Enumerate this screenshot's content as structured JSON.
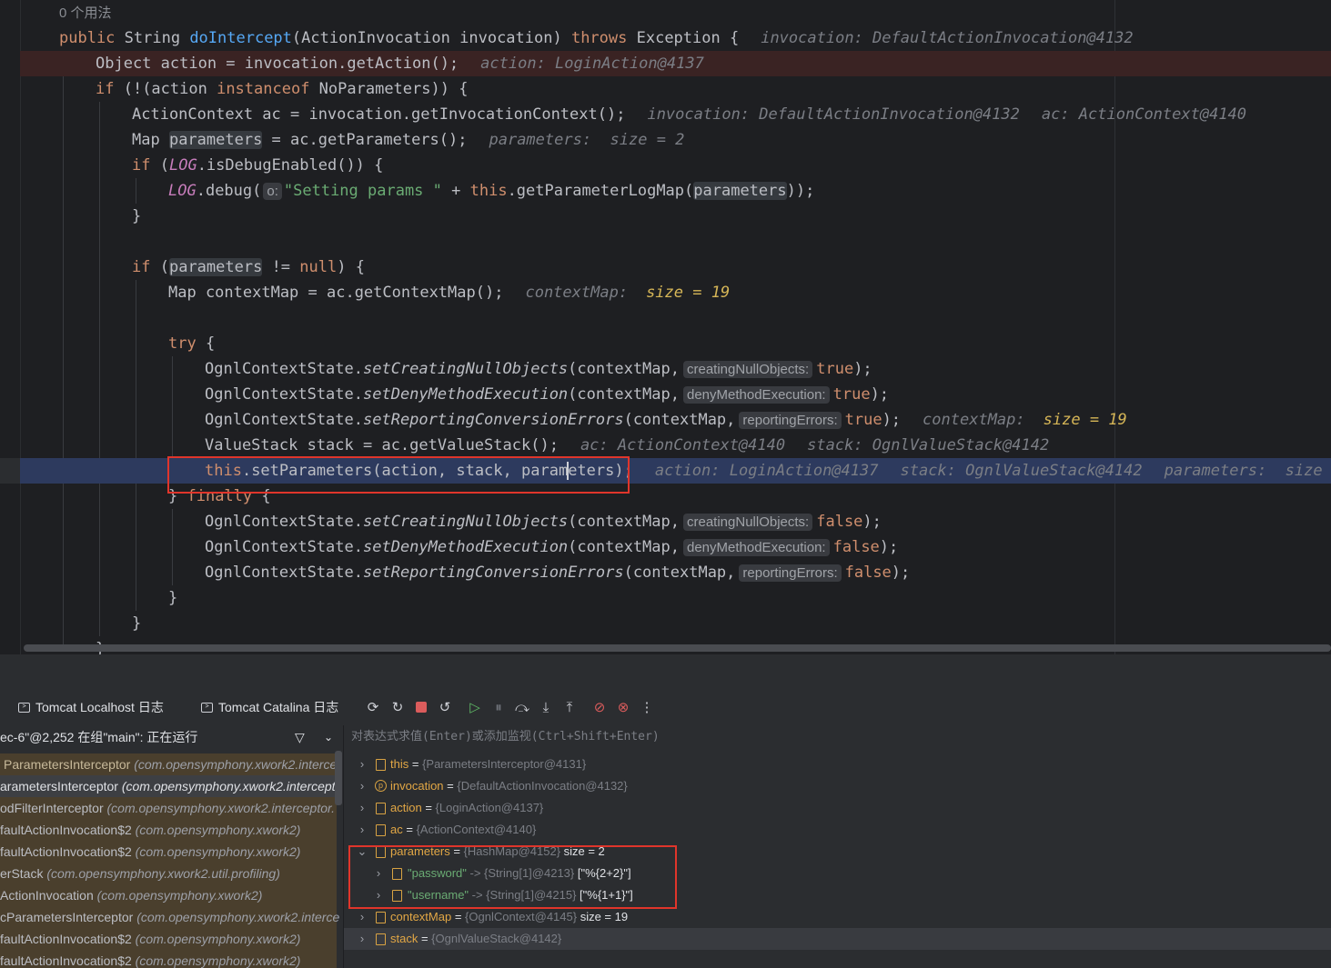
{
  "editor": {
    "usage_hint": "0 个用法",
    "lines": {
      "l1_sig_public": "public",
      "l1_sig_type": " String ",
      "l1_sig_name": "doIntercept",
      "l1_sig_params": "(ActionInvocation invocation) ",
      "l1_sig_throws": "throws",
      "l1_sig_exc": " Exception {",
      "l1_hint": "invocation: DefaultActionInvocation@4132",
      "l2_code": "Object action = invocation.getAction();",
      "l2_hint": "action: LoginAction@4137",
      "l3_if": "if",
      "l3_a": " (!(action ",
      "l3_inst": "instanceof",
      "l3_b": " NoParameters)) {",
      "l4_code": "ActionContext ac = invocation.getInvocationContext();",
      "l4_hint1": "invocation: DefaultActionInvocation@4132",
      "l4_hint2": "ac: ActionContext@4140",
      "l5_a": "Map ",
      "l5_var": "parameters",
      "l5_b": " = ac.getParameters();",
      "l5_hint": "parameters:  size = 2",
      "l6_if": "if",
      "l6_a": " (",
      "l6_log": "LOG",
      "l6_b": ".isDebugEnabled()) {",
      "l7_log": "LOG",
      "l7_a": ".debug(",
      "l7_hint": "o:",
      "l7_str": "\"Setting params \"",
      "l7_b": " + ",
      "l7_this": "this",
      "l7_c": ".getParameterLogMap(",
      "l7_var": "parameters",
      "l7_d": "));",
      "l8": "}",
      "l10_if": "if",
      "l10_a": " (",
      "l10_var": "parameters",
      "l10_b": " != ",
      "l10_null": "null",
      "l10_c": ") {",
      "l11_code": "Map contextMap = ac.getContextMap();",
      "l11_hint_a": "contextMap:",
      "l11_hint_b": "size = 19",
      "l13_try": "try",
      "l13_a": " {",
      "l14_a": "OgnlContextState.",
      "l14_m": "setCreatingNullObjects",
      "l14_b": "(contextMap,",
      "l14_hint": "creatingNullObjects:",
      "l14_val": "true",
      "l14_c": ");",
      "l15_a": "OgnlContextState.",
      "l15_m": "setDenyMethodExecution",
      "l15_b": "(contextMap,",
      "l15_hint": "denyMethodExecution:",
      "l15_val": "true",
      "l15_c": ");",
      "l16_a": "OgnlContextState.",
      "l16_m": "setReportingConversionErrors",
      "l16_b": "(contextMap,",
      "l16_hint": "reportingErrors:",
      "l16_val": "true",
      "l16_c": ");",
      "l16_ih_a": "contextMap:",
      "l16_ih_b": "size = 19",
      "l17_code": "ValueStack stack = ac.getValueStack();",
      "l17_hint1": "ac: ActionContext@4140",
      "l17_hint2": "stack: OgnlValueStack@4142",
      "l18_this": "this",
      "l18_a": ".setParameters(action, stack, param",
      "l18_b": "eters);",
      "l18_hint1": "action: LoginAction@4137",
      "l18_hint2": "stack: OgnlValueStack@4142",
      "l18_hint3": "parameters:  size",
      "l19_a": "} ",
      "l19_finally": "finally",
      "l19_b": " {",
      "l20_a": "OgnlContextState.",
      "l20_m": "setCreatingNullObjects",
      "l20_b": "(contextMap,",
      "l20_hint": "creatingNullObjects:",
      "l20_val": "false",
      "l20_c": ");",
      "l21_a": "OgnlContextState.",
      "l21_m": "setDenyMethodExecution",
      "l21_b": "(contextMap,",
      "l21_hint": "denyMethodExecution:",
      "l21_val": "false",
      "l21_c": ");",
      "l22_a": "OgnlContextState.",
      "l22_m": "setReportingConversionErrors",
      "l22_b": "(contextMap,",
      "l22_hint": "reportingErrors:",
      "l22_val": "false",
      "l22_c": ");",
      "l23": "}",
      "l24": "}",
      "l25": "}"
    }
  },
  "debugger": {
    "tabs": [
      "Tomcat Localhost 日志",
      "Tomcat Catalina 日志"
    ],
    "toolbar_icons": [
      "rerun-icon",
      "rerun-debug-icon",
      "stop-icon",
      "restart-icon",
      "resume-icon",
      "pause-icon",
      "step-over-icon",
      "step-into-icon",
      "step-out-icon",
      "view-breakpoints-icon",
      "mute-breakpoints-icon",
      "more-icon"
    ],
    "thread_label": "ec-6\"@2,252 在组\"main\": 正在运行",
    "eval_placeholder": "对表达式求值(Enter)或添加监视(Ctrl+Shift+Enter)",
    "frames": [
      {
        "method": "ParametersInterceptor",
        "cls": "(com.opensymphony.xwork2.interce"
      },
      {
        "method": "arametersInterceptor",
        "cls": "(com.opensymphony.xwork2.intercepto"
      },
      {
        "method": "odFilterInterceptor",
        "cls": "(com.opensymphony.xwork2.interceptor."
      },
      {
        "method": "faultActionInvocation$2",
        "cls": "(com.opensymphony.xwork2)"
      },
      {
        "method": "faultActionInvocation$2",
        "cls": "(com.opensymphony.xwork2)"
      },
      {
        "method": "erStack",
        "cls": "(com.opensymphony.xwork2.util.profiling)"
      },
      {
        "method": "ActionInvocation",
        "cls": "(com.opensymphony.xwork2)"
      },
      {
        "method": "cParametersInterceptor",
        "cls": "(com.opensymphony.xwork2.interce"
      },
      {
        "method": "faultActionInvocation$2",
        "cls": "(com.opensymphony.xwork2)"
      },
      {
        "method": "faultActionInvocation$2",
        "cls": "(com.opensymphony.xwork2)"
      }
    ],
    "variables": {
      "this_name": "this",
      "this_eq": " = ",
      "this_val": "{ParametersInterceptor@4131}",
      "inv_name": "invocation",
      "inv_eq": " = ",
      "inv_val": "{DefaultActionInvocation@4132}",
      "action_name": "action",
      "action_eq": " = ",
      "action_val": "{LoginAction@4137}",
      "ac_name": "ac",
      "ac_eq": " = ",
      "ac_val": "{ActionContext@4140}",
      "params_name": "parameters",
      "params_eq": " = ",
      "params_val": "{HashMap@4152}",
      "params_size": "  size = 2",
      "pw_key": "\"password\"",
      "pw_arrow": " -> ",
      "pw_type": "{String[1]@4213}",
      "pw_val": " [\"%{2+2}\"]",
      "un_key": "\"username\"",
      "un_arrow": " -> ",
      "un_type": "{String[1]@4215}",
      "un_val": " [\"%{1+1}\"]",
      "cm_name": "contextMap",
      "cm_eq": " = ",
      "cm_val": "{OgnlContext@4145}",
      "cm_size": "  size = 19",
      "stack_name": "stack",
      "stack_eq": " = ",
      "stack_val": "{OgnlValueStack@4142}"
    }
  }
}
